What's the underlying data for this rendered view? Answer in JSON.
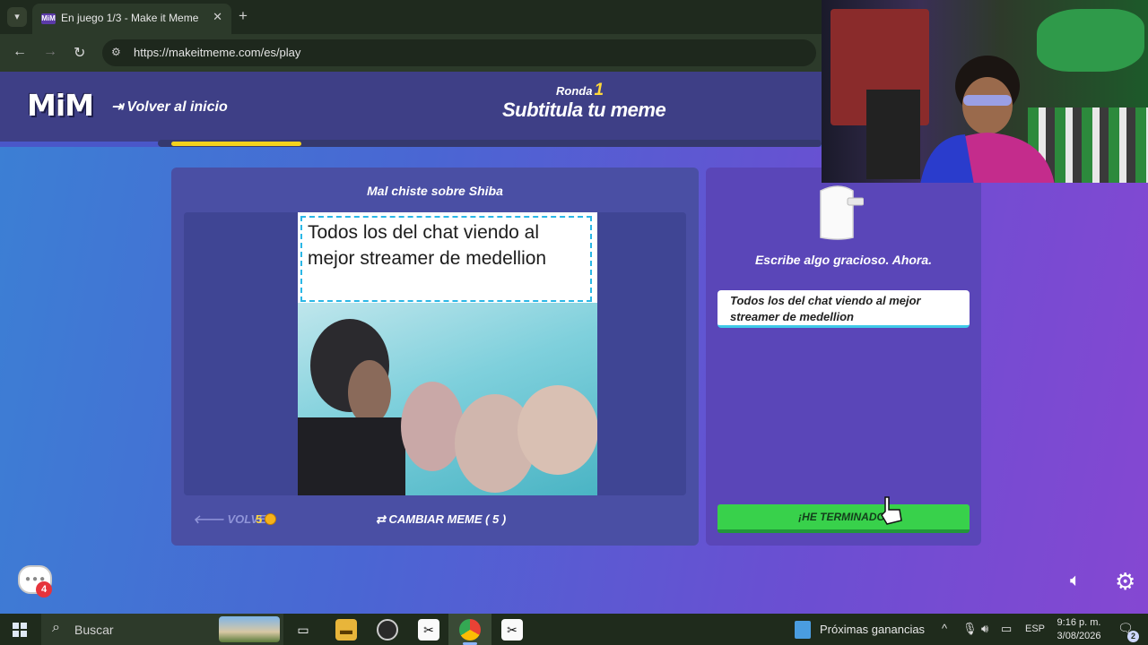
{
  "browser": {
    "tab_title": "En juego 1/3 - Make it Meme",
    "tab_favicon": "MiM",
    "url": "https://makeitmeme.com/es/play"
  },
  "header": {
    "logo": "MiM",
    "back_home": "Volver al inicio",
    "round_label": "Ronda",
    "round_number": "1",
    "phase_title": "Subtitula tu meme",
    "progress_fraction": 0.2
  },
  "meme_panel": {
    "meme_name": "Mal chiste sobre Shiba",
    "caption": "Todos los del chat viendo al mejor streamer de medellion",
    "back_label": "VOLVER",
    "coins": "5",
    "change_meme_label": "CAMBIAR MEME ( 5 )"
  },
  "answer_panel": {
    "prompt": "Escribe algo gracioso. Ahora.",
    "input_value": "Todos los del chat viendo al mejor streamer de medellion",
    "done_label": "¡HE TERMINADO!"
  },
  "overlay": {
    "chat_badge": "4"
  },
  "taskbar": {
    "search_label": "Buscar",
    "news_label": "Próximas ganancias",
    "lang": "ESP",
    "time": "9:16 p. m.",
    "date": "3/08/2026",
    "notif_count": "2"
  },
  "colors": {
    "accent_yellow": "#f5d21c",
    "done_green": "#38d14b",
    "panel_purple": "#4a4fa4",
    "input_border": "#3ec9e8"
  }
}
